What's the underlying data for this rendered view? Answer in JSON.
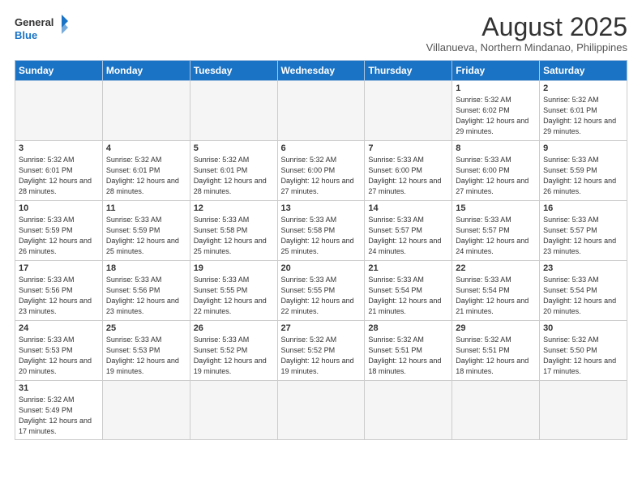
{
  "logo": {
    "text_general": "General",
    "text_blue": "Blue"
  },
  "header": {
    "month_year": "August 2025",
    "location": "Villanueva, Northern Mindanao, Philippines"
  },
  "weekdays": [
    "Sunday",
    "Monday",
    "Tuesday",
    "Wednesday",
    "Thursday",
    "Friday",
    "Saturday"
  ],
  "weeks": [
    [
      {
        "day": "",
        "info": ""
      },
      {
        "day": "",
        "info": ""
      },
      {
        "day": "",
        "info": ""
      },
      {
        "day": "",
        "info": ""
      },
      {
        "day": "",
        "info": ""
      },
      {
        "day": "1",
        "info": "Sunrise: 5:32 AM\nSunset: 6:02 PM\nDaylight: 12 hours and 29 minutes."
      },
      {
        "day": "2",
        "info": "Sunrise: 5:32 AM\nSunset: 6:01 PM\nDaylight: 12 hours and 29 minutes."
      }
    ],
    [
      {
        "day": "3",
        "info": "Sunrise: 5:32 AM\nSunset: 6:01 PM\nDaylight: 12 hours and 28 minutes."
      },
      {
        "day": "4",
        "info": "Sunrise: 5:32 AM\nSunset: 6:01 PM\nDaylight: 12 hours and 28 minutes."
      },
      {
        "day": "5",
        "info": "Sunrise: 5:32 AM\nSunset: 6:01 PM\nDaylight: 12 hours and 28 minutes."
      },
      {
        "day": "6",
        "info": "Sunrise: 5:32 AM\nSunset: 6:00 PM\nDaylight: 12 hours and 27 minutes."
      },
      {
        "day": "7",
        "info": "Sunrise: 5:33 AM\nSunset: 6:00 PM\nDaylight: 12 hours and 27 minutes."
      },
      {
        "day": "8",
        "info": "Sunrise: 5:33 AM\nSunset: 6:00 PM\nDaylight: 12 hours and 27 minutes."
      },
      {
        "day": "9",
        "info": "Sunrise: 5:33 AM\nSunset: 5:59 PM\nDaylight: 12 hours and 26 minutes."
      }
    ],
    [
      {
        "day": "10",
        "info": "Sunrise: 5:33 AM\nSunset: 5:59 PM\nDaylight: 12 hours and 26 minutes."
      },
      {
        "day": "11",
        "info": "Sunrise: 5:33 AM\nSunset: 5:59 PM\nDaylight: 12 hours and 25 minutes."
      },
      {
        "day": "12",
        "info": "Sunrise: 5:33 AM\nSunset: 5:58 PM\nDaylight: 12 hours and 25 minutes."
      },
      {
        "day": "13",
        "info": "Sunrise: 5:33 AM\nSunset: 5:58 PM\nDaylight: 12 hours and 25 minutes."
      },
      {
        "day": "14",
        "info": "Sunrise: 5:33 AM\nSunset: 5:57 PM\nDaylight: 12 hours and 24 minutes."
      },
      {
        "day": "15",
        "info": "Sunrise: 5:33 AM\nSunset: 5:57 PM\nDaylight: 12 hours and 24 minutes."
      },
      {
        "day": "16",
        "info": "Sunrise: 5:33 AM\nSunset: 5:57 PM\nDaylight: 12 hours and 23 minutes."
      }
    ],
    [
      {
        "day": "17",
        "info": "Sunrise: 5:33 AM\nSunset: 5:56 PM\nDaylight: 12 hours and 23 minutes."
      },
      {
        "day": "18",
        "info": "Sunrise: 5:33 AM\nSunset: 5:56 PM\nDaylight: 12 hours and 23 minutes."
      },
      {
        "day": "19",
        "info": "Sunrise: 5:33 AM\nSunset: 5:55 PM\nDaylight: 12 hours and 22 minutes."
      },
      {
        "day": "20",
        "info": "Sunrise: 5:33 AM\nSunset: 5:55 PM\nDaylight: 12 hours and 22 minutes."
      },
      {
        "day": "21",
        "info": "Sunrise: 5:33 AM\nSunset: 5:54 PM\nDaylight: 12 hours and 21 minutes."
      },
      {
        "day": "22",
        "info": "Sunrise: 5:33 AM\nSunset: 5:54 PM\nDaylight: 12 hours and 21 minutes."
      },
      {
        "day": "23",
        "info": "Sunrise: 5:33 AM\nSunset: 5:54 PM\nDaylight: 12 hours and 20 minutes."
      }
    ],
    [
      {
        "day": "24",
        "info": "Sunrise: 5:33 AM\nSunset: 5:53 PM\nDaylight: 12 hours and 20 minutes."
      },
      {
        "day": "25",
        "info": "Sunrise: 5:33 AM\nSunset: 5:53 PM\nDaylight: 12 hours and 19 minutes."
      },
      {
        "day": "26",
        "info": "Sunrise: 5:33 AM\nSunset: 5:52 PM\nDaylight: 12 hours and 19 minutes."
      },
      {
        "day": "27",
        "info": "Sunrise: 5:32 AM\nSunset: 5:52 PM\nDaylight: 12 hours and 19 minutes."
      },
      {
        "day": "28",
        "info": "Sunrise: 5:32 AM\nSunset: 5:51 PM\nDaylight: 12 hours and 18 minutes."
      },
      {
        "day": "29",
        "info": "Sunrise: 5:32 AM\nSunset: 5:51 PM\nDaylight: 12 hours and 18 minutes."
      },
      {
        "day": "30",
        "info": "Sunrise: 5:32 AM\nSunset: 5:50 PM\nDaylight: 12 hours and 17 minutes."
      }
    ],
    [
      {
        "day": "31",
        "info": "Sunrise: 5:32 AM\nSunset: 5:49 PM\nDaylight: 12 hours and 17 minutes."
      },
      {
        "day": "",
        "info": ""
      },
      {
        "day": "",
        "info": ""
      },
      {
        "day": "",
        "info": ""
      },
      {
        "day": "",
        "info": ""
      },
      {
        "day": "",
        "info": ""
      },
      {
        "day": "",
        "info": ""
      }
    ]
  ]
}
